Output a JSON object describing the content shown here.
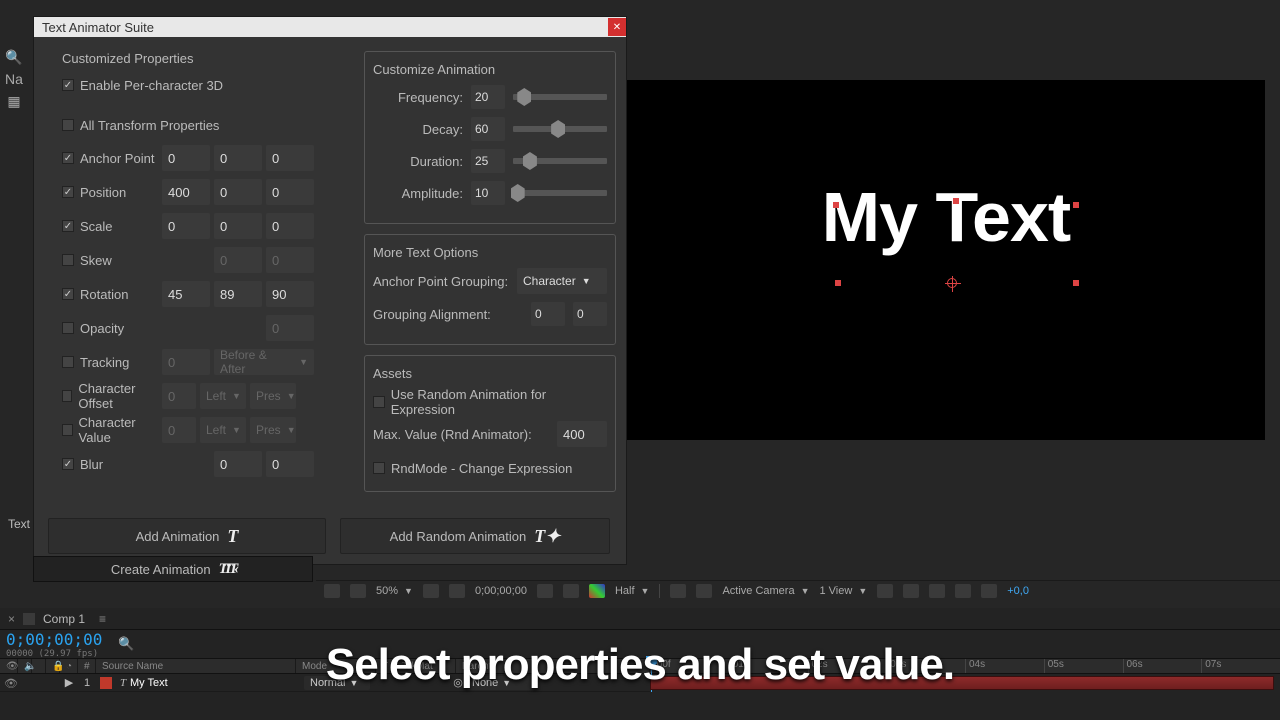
{
  "dialog": {
    "title": "Text Animator Suite",
    "customized_title": "Customized Properties",
    "enable3d": "Enable Per-character 3D",
    "alltransform": "All Transform Properties",
    "props": {
      "anchor": {
        "label": "Anchor Point",
        "v": [
          "0",
          "0",
          "0"
        ]
      },
      "position": {
        "label": "Position",
        "v": [
          "400",
          "0",
          "0"
        ]
      },
      "scale": {
        "label": "Scale",
        "v": [
          "0",
          "0",
          "0"
        ]
      },
      "skew": {
        "label": "Skew",
        "v": [
          "0",
          "0"
        ]
      },
      "rotation": {
        "label": "Rotation",
        "v": [
          "45",
          "89",
          "90"
        ]
      },
      "opacity": {
        "label": "Opacity",
        "v": [
          "0"
        ]
      },
      "tracking": {
        "label": "Tracking",
        "v": [
          "0"
        ],
        "sel": "Before & After"
      },
      "charoff": {
        "label": "Character Offset",
        "v": [
          "0"
        ],
        "sel1": "Left",
        "sel2": "Pres"
      },
      "charval": {
        "label": "Character Value",
        "v": [
          "0"
        ],
        "sel1": "Left",
        "sel2": "Pres"
      },
      "blur": {
        "label": "Blur",
        "v": [
          "0",
          "0"
        ]
      }
    },
    "customize_title": "Customize Animation",
    "sliders": {
      "frequency": {
        "label": "Frequency:",
        "val": "20",
        "pct": 12
      },
      "decay": {
        "label": "Decay:",
        "val": "60",
        "pct": 48
      },
      "duration": {
        "label": "Duration:",
        "val": "25",
        "pct": 18
      },
      "amplitude": {
        "label": "Amplitude:",
        "val": "10",
        "pct": 5
      }
    },
    "more_title": "More Text Options",
    "anchor_group_label": "Anchor Point Grouping:",
    "anchor_group_value": "Character",
    "grouping_align_label": "Grouping Alignment:",
    "grouping_align": [
      "0",
      "0"
    ],
    "assets_title": "Assets",
    "userand_label": "Use Random Animation for Expression",
    "maxval_label": "Max. Value (Rnd Animator):",
    "maxval": "400",
    "rndmode_label": "RndMode - Change Expression",
    "btn_add": "Add Animation",
    "btn_addrand": "Add Random Animation",
    "btn_create": "Create Animation"
  },
  "sidebar": {
    "text_label": "Text",
    "name_hint": "Na"
  },
  "preview": {
    "text": "My Text"
  },
  "viewbar": {
    "zoom": "50%",
    "timecode": "0;00;00;00",
    "res": "Half",
    "camera": "Active Camera",
    "views": "1 View",
    "offs": "+0,0"
  },
  "timeline": {
    "comp": "Comp 1",
    "tc": "0;00;00;00",
    "tc_sub": "00000 (29.97 fps)",
    "heads": {
      "num": "#",
      "src": "Source Name",
      "mode": "Mode",
      "t": "T",
      "trk": "TrkMat",
      "parent": "Parent"
    },
    "layer": {
      "num": "1",
      "name": "My Text",
      "mode": "Normal",
      "parent": "None"
    },
    "ticks": [
      ":00f",
      "01s",
      "02s",
      "03s",
      "04s",
      "05s",
      "06s",
      "07s"
    ]
  },
  "caption": "Select properties and set value."
}
